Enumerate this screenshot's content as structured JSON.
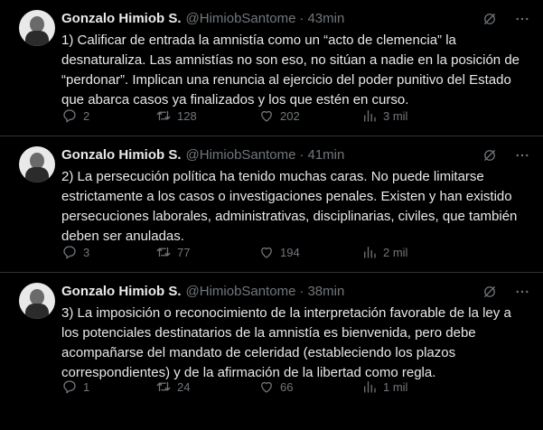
{
  "tweets": [
    {
      "name": "Gonzalo Himiob S.",
      "handle": "@HimiobSantome",
      "separator": "·",
      "time": "43min",
      "text": "1) Calificar de entrada la amnistía como un “acto de clemencia” la desnaturaliza. Las amnistías no son eso, no sitúan a nadie en la posición de “perdonar”. Implican una renuncia al ejercicio del poder punitivo del Estado que abarca casos ya finalizados y los que estén en curso.",
      "replies": "2",
      "retweets": "128",
      "likes": "202",
      "views": "3 mil"
    },
    {
      "name": "Gonzalo Himiob S.",
      "handle": "@HimiobSantome",
      "separator": "·",
      "time": "41min",
      "text": "2) La persecución política ha tenido muchas caras. No puede limitarse estrictamente a los casos o investigaciones penales. Existen y han existido persecuciones laborales, administrativas, disciplinarias, civiles, que también deben ser anuladas.",
      "replies": "3",
      "retweets": "77",
      "likes": "194",
      "views": "2 mil"
    },
    {
      "name": "Gonzalo Himiob S.",
      "handle": "@HimiobSantome",
      "separator": "·",
      "time": "38min",
      "text": "3) La imposición o reconocimiento de la interpretación favorable de la ley a los potenciales destinatarios de la amnistía es bienvenida, pero debe acompañarse del mandato de celeridad (estableciendo los plazos correspondientes) y de la afirmación de la libertad como regla.",
      "replies": "1",
      "retweets": "24",
      "likes": "66",
      "views": "1 mil"
    }
  ]
}
